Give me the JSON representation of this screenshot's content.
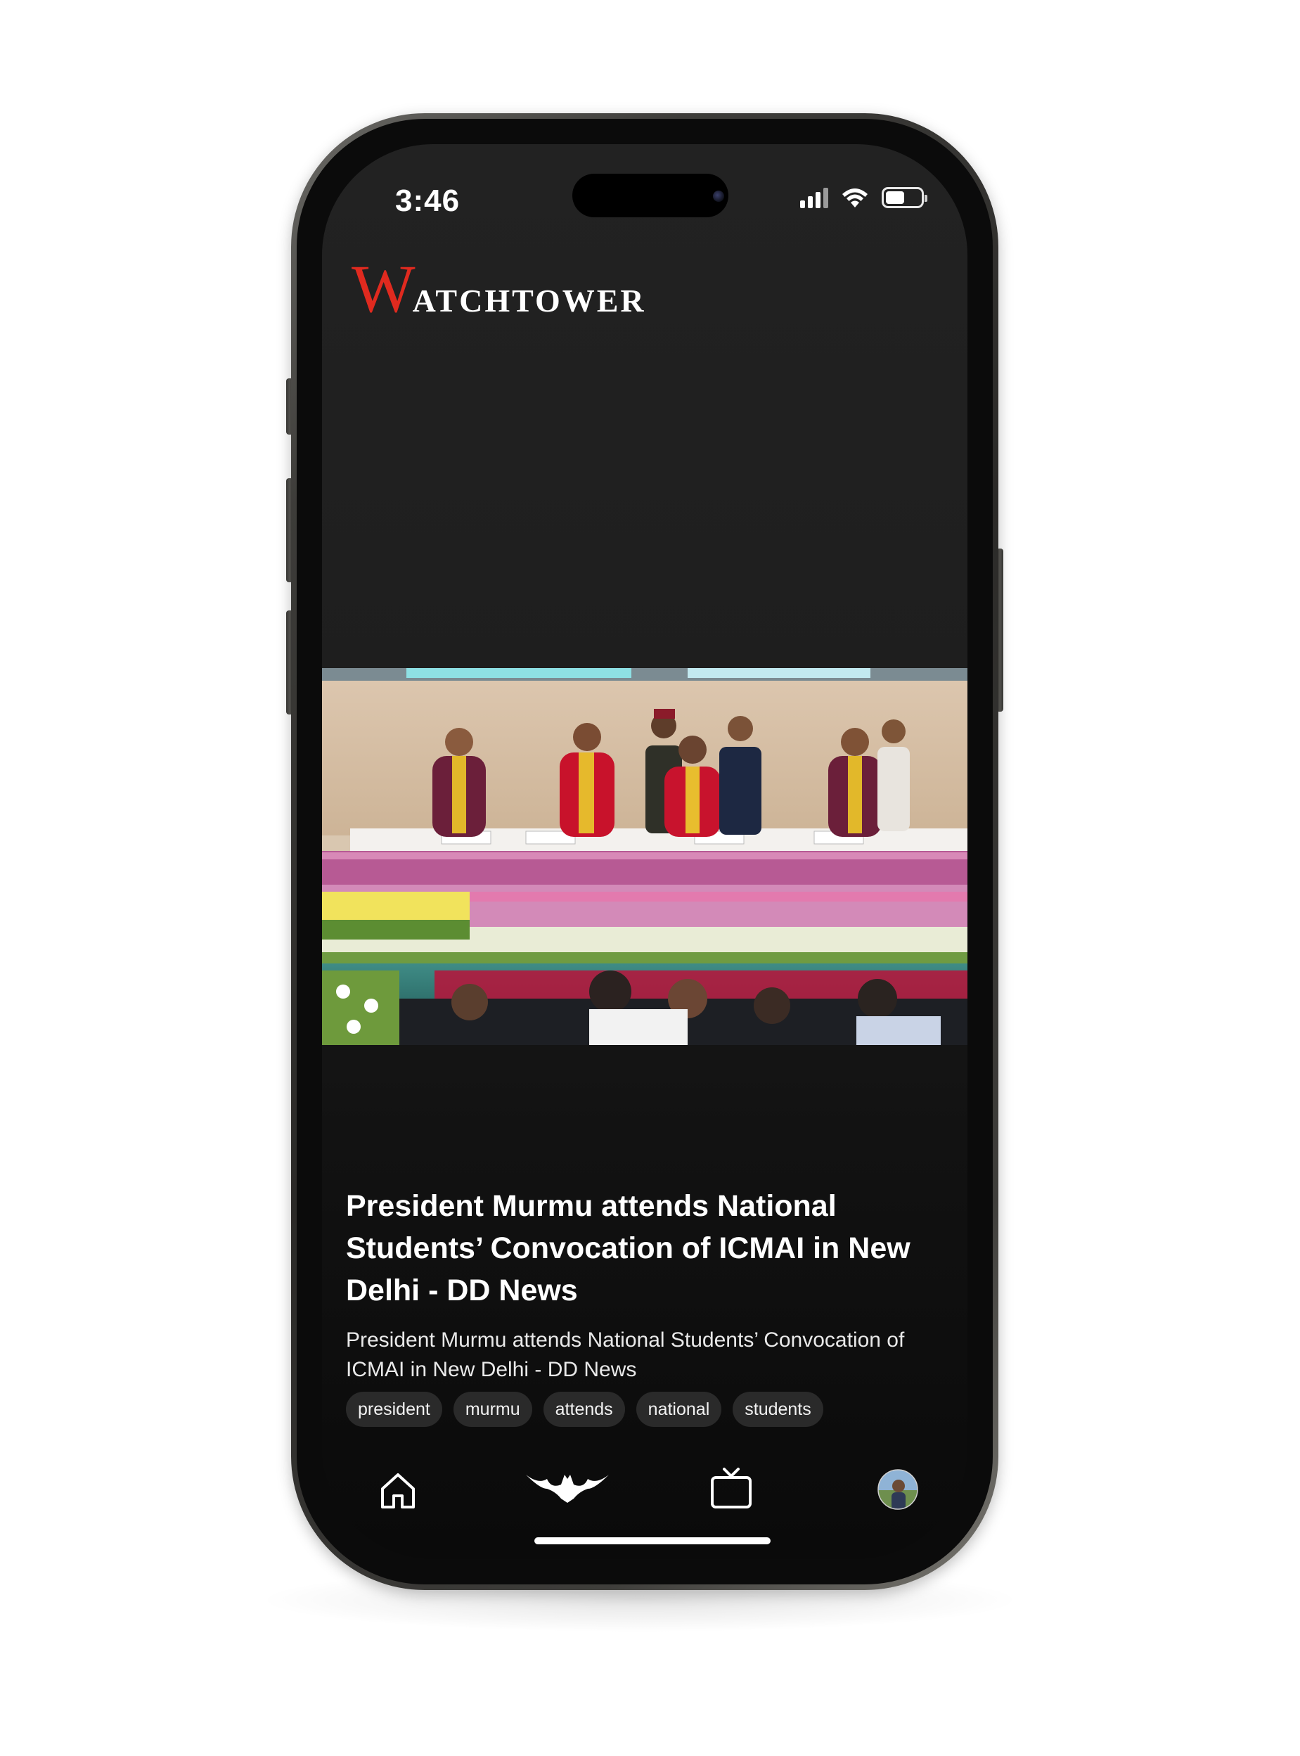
{
  "status_bar": {
    "time": "3:46",
    "signal_icon": "cellular-signal-icon",
    "wifi_icon": "wifi-icon",
    "battery_icon": "battery-icon",
    "battery_level": 0.55
  },
  "app": {
    "logo_initial": "W",
    "logo_rest": "atchTower",
    "logo_color": "#e02a1f"
  },
  "article": {
    "title": "President Murmu attends National Students’ Convocation of ICMAI in New Delhi - DD News",
    "summary": "President Murmu attends National Students’ Convocation of ICMAI in New Delhi - DD News",
    "tags": [
      "president",
      "murmu",
      "attends",
      "national",
      "students"
    ]
  },
  "tab_bar": {
    "items": [
      {
        "icon": "home-icon"
      },
      {
        "icon": "bat-logo-icon"
      },
      {
        "icon": "tv-icon"
      },
      {
        "icon": "profile-avatar"
      }
    ]
  },
  "colors": {
    "background": "#1e1e1e",
    "accent": "#e02a1f",
    "tag_background": "#2a2a2a"
  }
}
